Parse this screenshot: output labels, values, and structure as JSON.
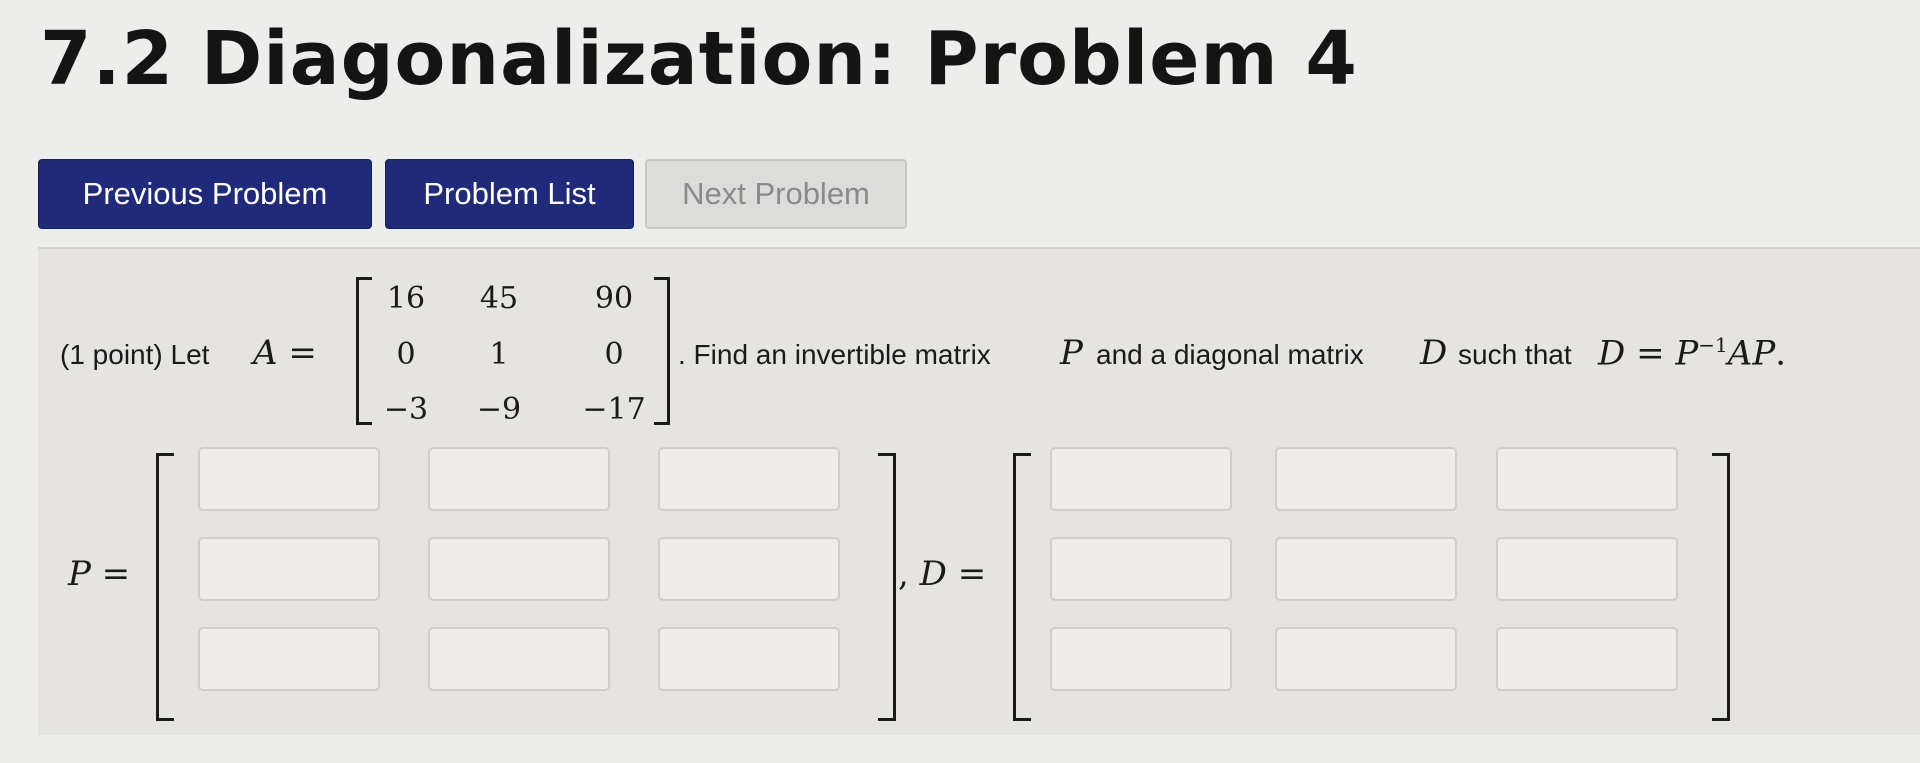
{
  "page": {
    "title": "7.2 Diagonalization: Problem 4"
  },
  "nav": {
    "previous_label": "Previous Problem",
    "list_label": "Problem List",
    "next_label": "Next Problem"
  },
  "problem": {
    "points": "(1 point) Let",
    "matrix_name": "A",
    "equals": "=",
    "matrix_A": [
      [
        "16",
        "45",
        "90"
      ],
      [
        "0",
        "1",
        "0"
      ],
      [
        "−3",
        "−9",
        "−17"
      ]
    ],
    "text_find": ". Find an invertible matrix",
    "var_P": "P",
    "text_and": "and a diagonal matrix",
    "var_D": "D",
    "text_such": "such that",
    "equation_D": "D",
    "equation_eq": "=",
    "equation_P": "P",
    "equation_exp": "−1",
    "equation_AP": "AP",
    "period": "."
  },
  "answers": {
    "P_label": "P =",
    "D_label": "D =",
    "separator": ",",
    "P_values": [
      [
        "",
        "",
        ""
      ],
      [
        "",
        "",
        ""
      ],
      [
        "",
        "",
        ""
      ]
    ],
    "D_values": [
      [
        "",
        "",
        ""
      ],
      [
        "",
        "",
        ""
      ],
      [
        "",
        "",
        ""
      ]
    ]
  }
}
